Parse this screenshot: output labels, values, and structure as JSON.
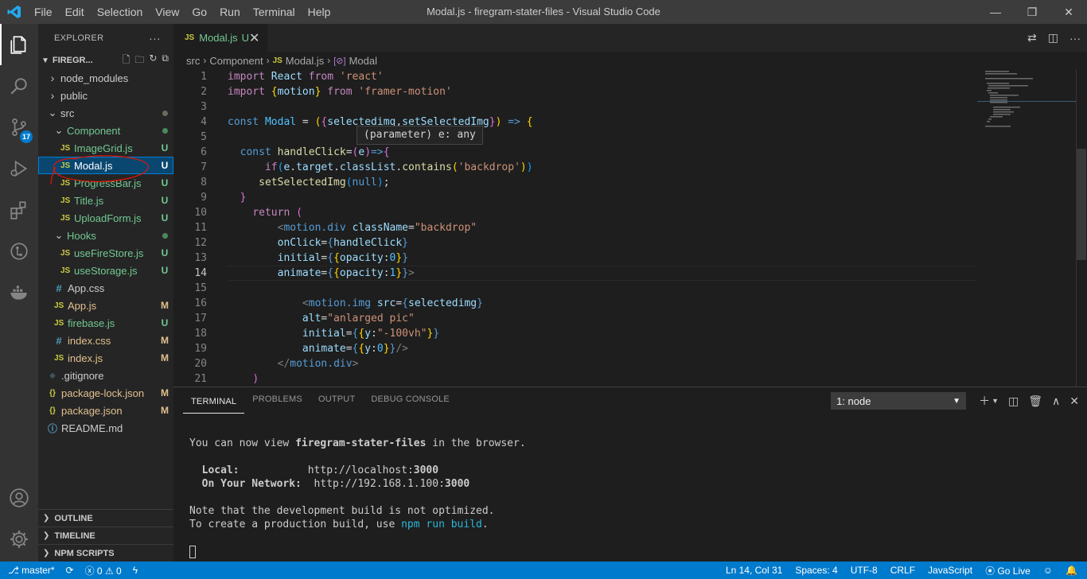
{
  "titlebar": {
    "menu": [
      "File",
      "Edit",
      "Selection",
      "View",
      "Go",
      "Run",
      "Terminal",
      "Help"
    ],
    "title": "Modal.js - firegram-stater-files - Visual Studio Code",
    "minimize": "—",
    "restore": "❐",
    "close": "✕"
  },
  "activity": {
    "items": [
      "explorer-icon",
      "search-icon",
      "source-control-icon",
      "run-debug-icon",
      "extensions-icon",
      "git-graph-icon",
      "docker-icon"
    ],
    "scm_badge": "17"
  },
  "sidebar": {
    "header": "EXPLORER",
    "more": "···",
    "project": "FIREGR...",
    "tree": [
      {
        "name": "node_modules",
        "type": "folder",
        "open": false,
        "indent": 1,
        "deco": ""
      },
      {
        "name": "public",
        "type": "folder",
        "open": false,
        "indent": 1,
        "deco": ""
      },
      {
        "name": "src",
        "type": "folder",
        "open": true,
        "indent": 1,
        "deco": "dot"
      },
      {
        "name": "Component",
        "type": "folder",
        "open": true,
        "indent": 2,
        "deco": "dotgreen",
        "cls": "untracked"
      },
      {
        "name": "ImageGrid.js",
        "type": "js",
        "indent": 3,
        "deco": "U",
        "cls": "untracked"
      },
      {
        "name": "Modal.js",
        "type": "js",
        "indent": 3,
        "deco": "U",
        "cls": "sel",
        "selected": true
      },
      {
        "name": "ProgressBar.js",
        "type": "js",
        "indent": 3,
        "deco": "U",
        "cls": "untracked"
      },
      {
        "name": "Title.js",
        "type": "js",
        "indent": 3,
        "deco": "U",
        "cls": "untracked"
      },
      {
        "name": "UploadForm.js",
        "type": "js",
        "indent": 3,
        "deco": "U",
        "cls": "untracked"
      },
      {
        "name": "Hooks",
        "type": "folder",
        "open": true,
        "indent": 2,
        "deco": "dotgreen",
        "cls": "untracked"
      },
      {
        "name": "useFireStore.js",
        "type": "js",
        "indent": 3,
        "deco": "U",
        "cls": "untracked"
      },
      {
        "name": "useStorage.js",
        "type": "js",
        "indent": 3,
        "deco": "U",
        "cls": "untracked"
      },
      {
        "name": "App.css",
        "type": "css",
        "indent": 2,
        "deco": "",
        "cls": "plain"
      },
      {
        "name": "App.js",
        "type": "js",
        "indent": 2,
        "deco": "M",
        "cls": "modified"
      },
      {
        "name": "firebase.js",
        "type": "js",
        "indent": 2,
        "deco": "U",
        "cls": "untracked"
      },
      {
        "name": "index.css",
        "type": "css",
        "indent": 2,
        "deco": "M",
        "cls": "modified"
      },
      {
        "name": "index.js",
        "type": "js",
        "indent": 2,
        "deco": "M",
        "cls": "modified"
      },
      {
        "name": ".gitignore",
        "type": "git",
        "indent": 1,
        "deco": "",
        "cls": "plain"
      },
      {
        "name": "package-lock.json",
        "type": "json",
        "indent": 1,
        "deco": "M",
        "cls": "modified"
      },
      {
        "name": "package.json",
        "type": "json",
        "indent": 1,
        "deco": "M",
        "cls": "modified"
      },
      {
        "name": "README.md",
        "type": "info",
        "indent": 1,
        "deco": "",
        "cls": "plain"
      }
    ],
    "sections": [
      "OUTLINE",
      "TIMELINE",
      "NPM SCRIPTS"
    ]
  },
  "editor": {
    "tab": {
      "icon": "JS",
      "name": "Modal.js",
      "status": "U",
      "close": "✕"
    },
    "breadcrumb": [
      "src",
      "Component",
      "Modal.js",
      "Modal"
    ],
    "hover": "(parameter) e: any",
    "current_line": 14
  },
  "panel": {
    "tabs": [
      "TERMINAL",
      "PROBLEMS",
      "OUTPUT",
      "DEBUG CONSOLE"
    ],
    "terminal_select": "1: node",
    "terminal": {
      "l1a": "You can now view ",
      "l1b": "firegram-stater-files",
      "l1c": " in the browser.",
      "local_label": "Local:",
      "local_url_a": "http://localhost:",
      "local_url_b": "3000",
      "net_label": "On Your Network:",
      "net_url_a": "http://192.168.1.100:",
      "net_url_b": "3000",
      "note1": "Note that the development build is not optimized.",
      "note2a": "To create a production build, use ",
      "note2b": "npm run build",
      "note2c": "."
    }
  },
  "statusbar": {
    "branch": "master*",
    "errors": "0",
    "warnings": "0",
    "position": "Ln 14, Col 31",
    "spaces": "Spaces: 4",
    "encoding": "UTF-8",
    "eol": "CRLF",
    "language": "JavaScript",
    "golive": "Go Live"
  },
  "colors": {
    "accent": "#007acc",
    "untracked": "#73c991",
    "modified": "#e2c08d",
    "annotation": "#e51400"
  }
}
